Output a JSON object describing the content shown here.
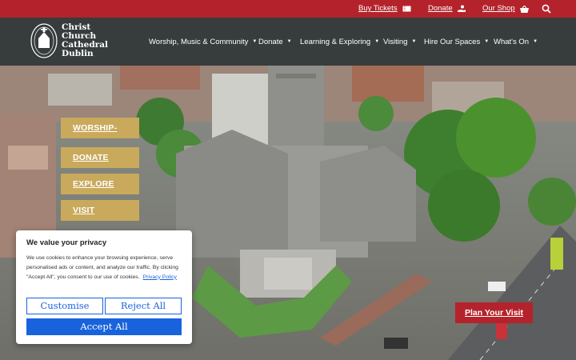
{
  "topbar": {
    "buy_tickets": "Buy Tickets",
    "donate": "Donate",
    "our_shop": "Our Shop"
  },
  "logo": {
    "line1": "Christ",
    "line2": "Church",
    "line3": "Cathedral",
    "line4": "Dublin"
  },
  "nav": {
    "items": [
      {
        "label": "Worship, Music & Community"
      },
      {
        "label": "Donate"
      },
      {
        "label": "Learning & Exploring"
      },
      {
        "label": "Visiting"
      },
      {
        "label": "Hire Our Spaces"
      },
      {
        "label": "What's On"
      }
    ]
  },
  "quick_links": [
    "WORSHIP-",
    "DONATE",
    "EXPLORE",
    "VISIT"
  ],
  "plan_visit": "Plan Your Visit",
  "cookie": {
    "title": "We value your privacy",
    "body": "We use cookies to enhance your browsing experience, serve personalised ads or content, and analyze our traffic. By clicking \"Accept All\", you consent to our use of cookies.",
    "policy_link": "Privacy Policy",
    "customise": "Customise",
    "reject": "Reject All",
    "accept": "Accept All"
  },
  "colors": {
    "brand_red": "#b4232b",
    "gold": "#c9a95b",
    "cookie_blue": "#1863dc"
  }
}
